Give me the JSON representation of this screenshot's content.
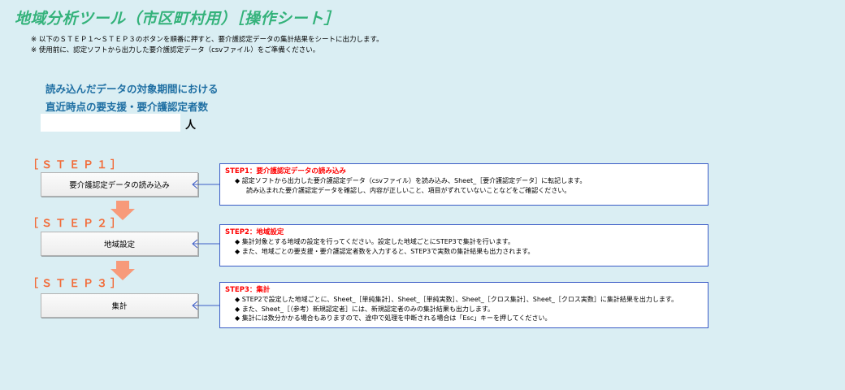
{
  "title": "地域分析ツール（市区町村用）［操作シート］",
  "notes": [
    "※ 以下のＳＴＥＰ１～ＳＴＥＰ３のボタンを順番に押すと、要介護認定データの集計結果をシートに出力します。",
    "※ 使用前に、認定ソフトから出力した要介護認定データ（csvファイル）をご準備ください。"
  ],
  "count": {
    "label_line1": "読み込んだデータの対象期間における",
    "label_line2": "直近時点の要支援・要介護認定者数",
    "value": "",
    "unit": "人"
  },
  "steps": [
    {
      "label": "［ＳＴＥＰ１］",
      "button": "要介護認定データの読み込み",
      "panel_title": "STEP1：要介護認定データの読み込み",
      "panel_lines": [
        "◆ 認定ソフトから出力した要介護認定データ（csvファイル）を読み込み、Sheet_［要介護認定データ］に転記します。",
        "読み込まれた要介護認定データを確認し、内容が正しいこと、項目がずれていないことなどをご確認ください。"
      ]
    },
    {
      "label": "［ＳＴＥＰ２］",
      "button": "地域設定",
      "panel_title": "STEP2：地域設定",
      "panel_lines": [
        "◆ 集計対象とする地域の設定を行ってください。設定した地域ごとにSTEP3で集計を行います。",
        "◆ また、地域ごとの要支援・要介護認定者数を入力すると、STEP3で実数の集計結果も出力されます。"
      ]
    },
    {
      "label": "［ＳＴＥＰ３］",
      "button": "集計",
      "panel_title": "STEP3：集計",
      "panel_lines": [
        "◆ STEP2で設定した地域ごとに、Sheet_［単純集計］、Sheet_［単純実数］、Sheet_［クロス集計］、Sheet_［クロス実数］に集計結果を出力します。",
        "◆ また、Sheet_［（参考）新規認定者］には、新規認定者のみの集計結果も出力します。",
        "◆ 集計には数分かかる場合もありますので、途中で処理を中断される場合は「Esc」キーを押してください。"
      ]
    }
  ],
  "colors": {
    "background": "#daeef3",
    "title": "#33b27a",
    "step_label": "#f26b38",
    "arrow": "#f79a7a",
    "panel_border": "#3b5cc6",
    "panel_title": "#ff0000",
    "count_label": "#1f6fa3"
  }
}
